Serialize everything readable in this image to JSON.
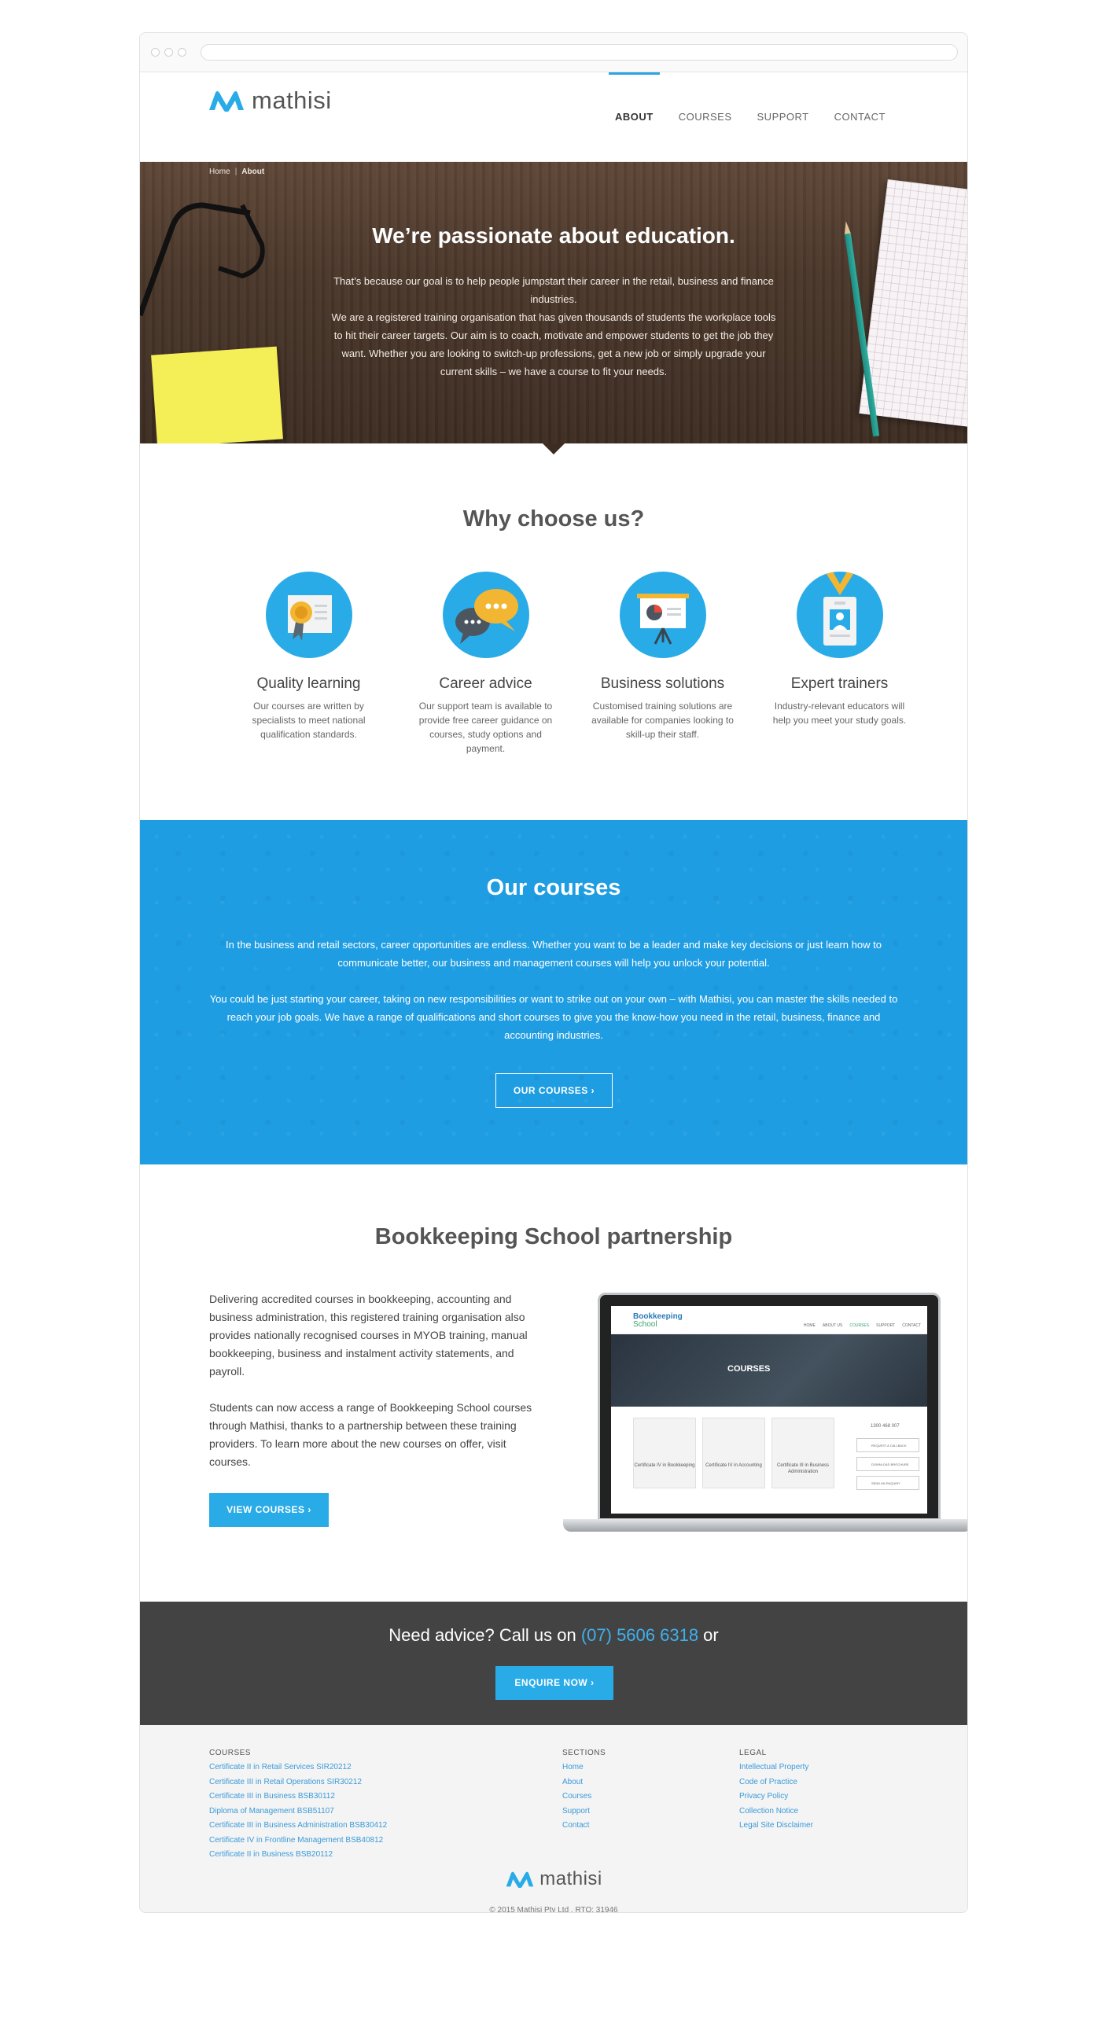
{
  "brand": {
    "name": "mathisi",
    "accent": "#29abe8",
    "dark": "#434343"
  },
  "nav": [
    {
      "label": "ABOUT",
      "active": true
    },
    {
      "label": "COURSES",
      "active": false
    },
    {
      "label": "SUPPORT",
      "active": false
    },
    {
      "label": "CONTACT",
      "active": false
    }
  ],
  "breadcrumb": {
    "home": "Home",
    "separator": "|",
    "current": "About"
  },
  "hero": {
    "title": "We’re passionate about education.",
    "paragraph1": "That’s because our goal is to help people jumpstart their career in the retail, business and finance industries.",
    "paragraph2": "We are a registered training organisation that has given thousands of students the workplace tools to hit their career targets. Our aim is to coach, motivate and empower students to get the job they want. Whether you are looking to switch-up professions, get a new job or simply upgrade your current skills – we have a course to fit your needs."
  },
  "why": {
    "title": "Why choose us?",
    "features": [
      {
        "icon": "certificate-icon",
        "title": "Quality learning",
        "text": "Our courses are written by specialists to meet national qualification standards."
      },
      {
        "icon": "chat-bubbles-icon",
        "title": "Career advice",
        "text": "Our support team is available to provide free career guidance on courses, study options and payment."
      },
      {
        "icon": "presentation-board-icon",
        "title": "Business solutions",
        "text": "Customised training solutions are available for companies looking to skill-up their staff."
      },
      {
        "icon": "id-badge-icon",
        "title": "Expert trainers",
        "text": "Industry-relevant educators will help you meet your study goals."
      }
    ]
  },
  "courses": {
    "title": "Our courses",
    "paragraph1": "In the business and retail sectors, career opportunities are endless. Whether you want to be a leader and make key decisions or just learn how to communicate better, our business and management courses will help you unlock your potential.",
    "paragraph2": "You could be just starting your career, taking on new responsibilities or want to strike out on your own – with Mathisi, you can master the skills needed to reach your job goals.  We have a range of qualifications and short courses to give you the know-how you need in the retail, business, finance and accounting industries.",
    "button": "OUR COURSES"
  },
  "bookkeeping": {
    "title": "Bookkeeping School partnership",
    "paragraph1": "Delivering accredited courses in bookkeeping, accounting and business administration, this registered training organisation also provides nationally recognised courses in MYOB training, manual bookkeeping, business and instalment activity statements, and payroll.",
    "paragraph2": "Students can now access a range of Bookkeeping School courses through Mathisi, thanks to a partnership between these training providers. To learn more about the new courses on offer, visit courses.",
    "button": "VIEW COURSES",
    "screen": {
      "logo_line1": "Bookkeeping",
      "logo_line2": "School",
      "nav": [
        "HOME",
        "ABOUT US",
        "COURSES",
        "SUPPORT",
        "CONTACT"
      ],
      "hero": "COURSES",
      "cards": [
        "Certificate IV in Bookkeeping",
        "Certificate IV in Accounting",
        "Certificate III in Business Administration"
      ],
      "side": [
        "1300 468 007",
        "REQUEST A CALLBACK",
        "DOWNLOAD BROCHURE",
        "SEND AN ENQUIRY"
      ]
    }
  },
  "advice": {
    "text_before": "Need advice? Call us on ",
    "phone": "(07) 5606 6318",
    "text_after": " or",
    "button": "ENQUIRE NOW"
  },
  "footer": {
    "courses_heading": "COURSES",
    "courses": [
      "Certificate II in Retail Services SIR20212",
      "Certificate III in Retail Operations SIR30212",
      "Certificate III in Business BSB30112",
      "Diploma of Management BSB51107",
      "Certificate III in Business Administration BSB30412",
      "Certificate IV in Frontline Management BSB40812",
      "Certificate II in Business BSB20112"
    ],
    "sections_heading": "SECTIONS",
    "sections": [
      "Home",
      "About",
      "Courses",
      "Support",
      "Contact"
    ],
    "legal_heading": "LEGAL",
    "legal": [
      "Intellectual Property",
      "Code of Practice",
      "Privacy Policy",
      "Collection Notice",
      "Legal Site Disclaimer"
    ],
    "logo": "mathisi",
    "copyright": "© 2015 Mathisi Pty Ltd . RTO: 31946"
  }
}
